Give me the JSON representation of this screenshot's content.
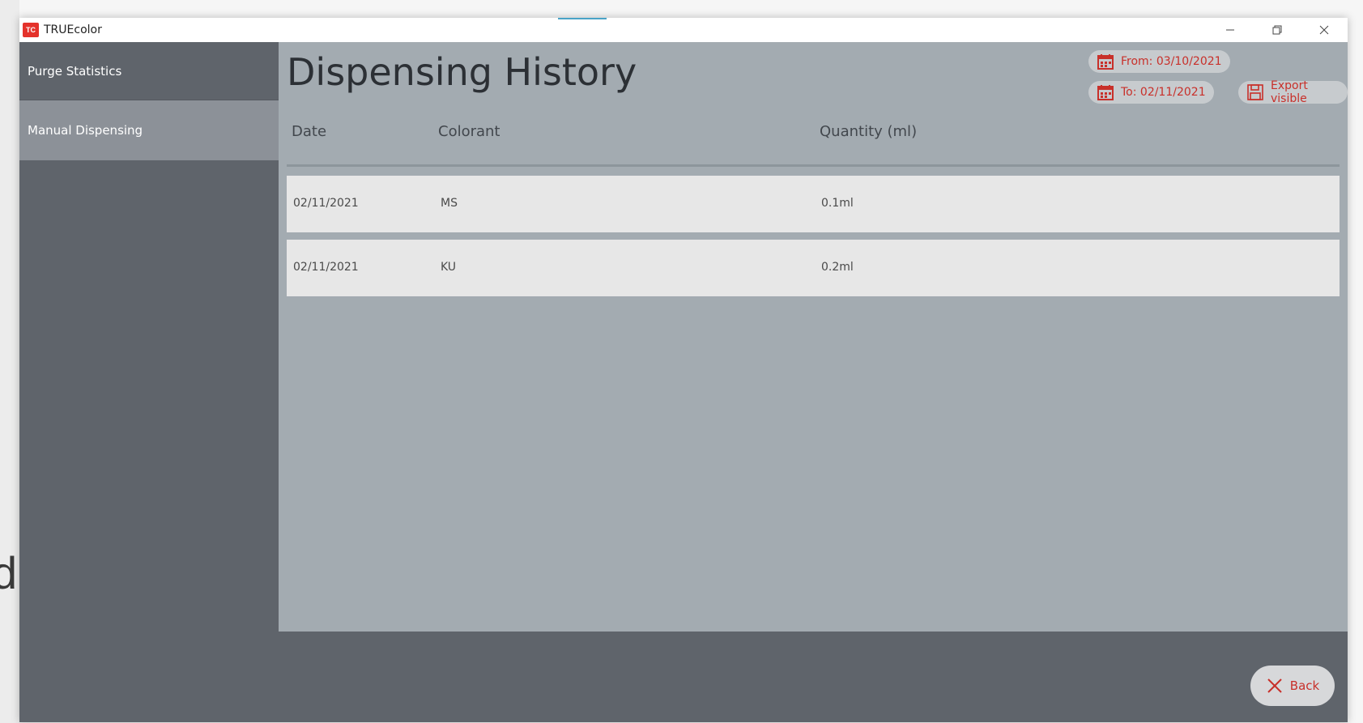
{
  "window": {
    "title": "TRUEcolor",
    "logo_text": "TC"
  },
  "stray_text": "d",
  "sidebar": {
    "items": [
      {
        "label": "Purge Statistics"
      },
      {
        "label": "Manual Dispensing",
        "active": true
      }
    ]
  },
  "main": {
    "title": "Dispensing History",
    "filters": {
      "from_label": "From: 03/10/2021",
      "to_label": "To: 02/11/2021",
      "export_label": "Export visible"
    },
    "table": {
      "columns": [
        "Date",
        "Colorant",
        "Quantity (ml)"
      ],
      "rows": [
        {
          "date": "02/11/2021",
          "colorant": "MS",
          "quantity": "0.1ml"
        },
        {
          "date": "02/11/2021",
          "colorant": "KU",
          "quantity": "0.2ml"
        }
      ]
    }
  },
  "footer": {
    "back_label": "Back"
  },
  "icons": {
    "calendar": "calendar-icon",
    "save": "save-icon",
    "close": "close-x-icon",
    "minimize": "minimize-icon",
    "restore": "restore-icon"
  },
  "colors": {
    "accent_red": "#c8302a",
    "sidebar_bg": "#5f646b",
    "sidebar_active": "#8c9198",
    "main_bg": "#a3abb1",
    "row_bg": "#e7e7e7",
    "pill_bg": "#c7cbce"
  }
}
